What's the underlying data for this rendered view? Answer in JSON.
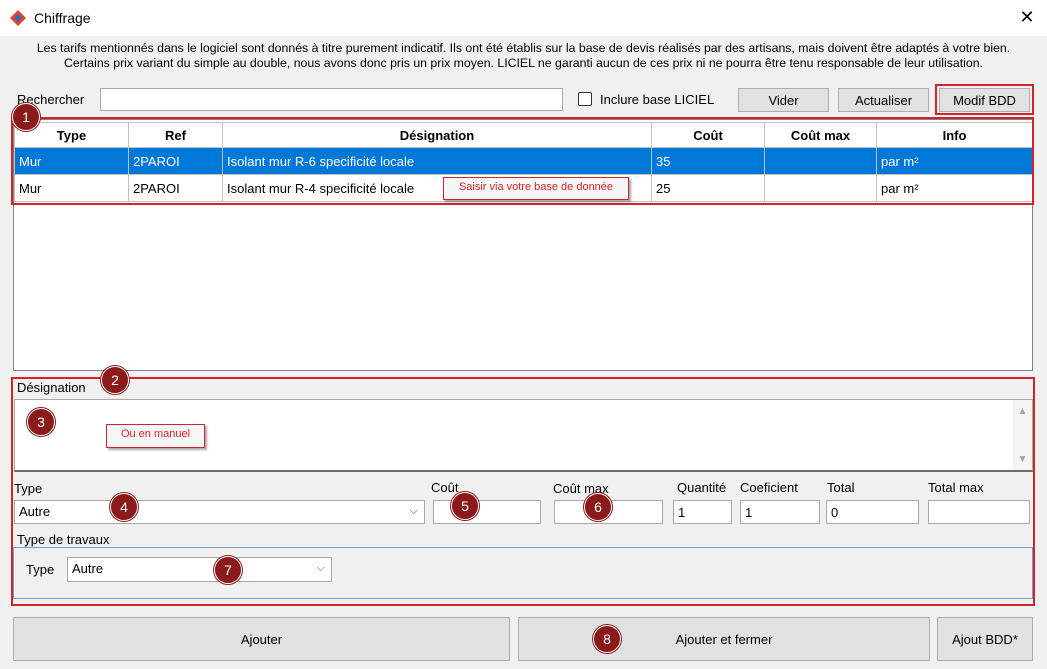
{
  "window": {
    "title": "Chiffrage",
    "close_glyph": "✕"
  },
  "disclaimer": {
    "line1": "Les tarifs mentionnés dans le logiciel sont donnés à titre purement indicatif. Ils ont été établis sur la base de devis réalisés par des artisans, mais doivent être adaptés à votre bien.",
    "line2": "Certains prix variant du simple au double, nous avons donc pris un prix moyen. LICIEL ne garanti aucun de ces prix ni ne pourra être tenu responsable de leur utilisation."
  },
  "search": {
    "label": "Rechercher",
    "value": "",
    "include_label": "Inclure base LICIEL",
    "include_checked": false
  },
  "toolbar": {
    "clear_label": "Vider",
    "refresh_label": "Actualiser",
    "modify_label": "Modif BDD"
  },
  "table": {
    "columns": [
      "Type",
      "Ref",
      "Désignation",
      "Coût",
      "Coût max",
      "Info"
    ],
    "rows": [
      {
        "type": "Mur",
        "ref": "2PAROI",
        "designation": "Isolant mur R-6 specificité locale",
        "cout": "35",
        "cout_max": "",
        "info": "par m²"
      },
      {
        "type": "Mur",
        "ref": "2PAROI",
        "designation": "Isolant mur R-4 specificité locale",
        "cout": "25",
        "cout_max": "",
        "info": "par m²"
      }
    ]
  },
  "annotations": {
    "b1": "1",
    "b2": "2",
    "b3": "3",
    "b4": "4",
    "b5": "5",
    "b6": "6",
    "b7": "7",
    "b8": "8",
    "note_db": "Saisir via votre base de donnée",
    "note_manual": "Ou en manuel"
  },
  "form": {
    "designation_label": "Désignation",
    "designation_value": "",
    "type_label": "Type",
    "type_value": "Autre",
    "cout_label": "Coût",
    "cout_value": "",
    "cout_max_label": "Coût max",
    "cout_max_value": "",
    "quantite_label": "Quantité",
    "quantite_value": "1",
    "coef_label": "Coeficient",
    "coef_value": "1",
    "total_label": "Total",
    "total_value": "0",
    "total_max_label": "Total max",
    "total_max_value": "",
    "travaux_group_label": "Type de travaux",
    "travaux_type_label": "Type",
    "travaux_type_value": "Autre"
  },
  "footer": {
    "add_label": "Ajouter",
    "add_close_label": "Ajouter et fermer",
    "add_db_label": "Ajout BDD*"
  },
  "colors": {
    "accent_red": "#d3232a",
    "badge": "#8b1a1a",
    "selection": "#0078d7"
  }
}
